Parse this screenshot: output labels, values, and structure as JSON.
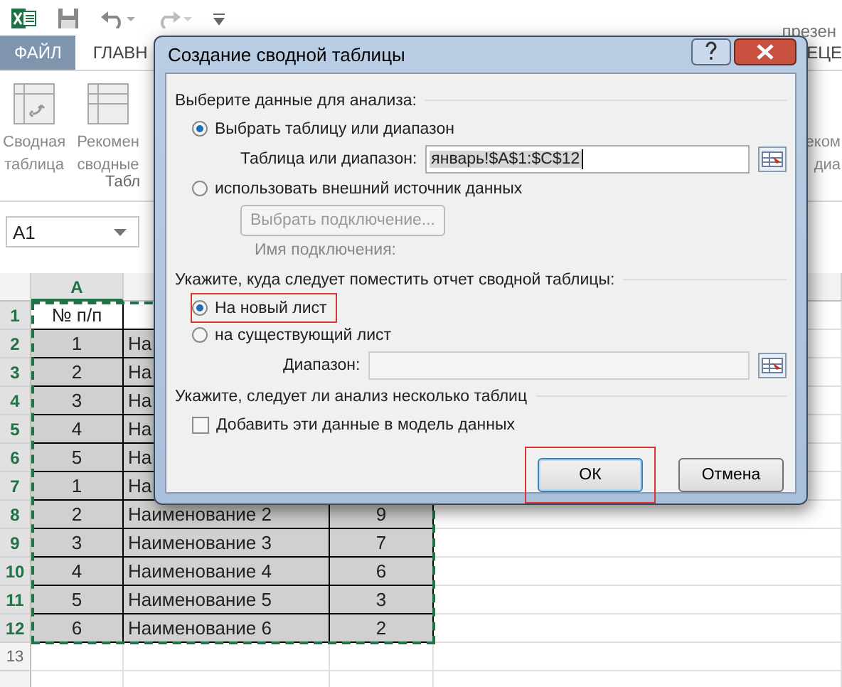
{
  "app": {
    "document_title": "презен"
  },
  "tabs": [
    {
      "label": "ФАЙЛ",
      "kind": "file"
    },
    {
      "label": "ГЛАВН",
      "kind": "tab"
    },
    {
      "label": "ЕЦЕ",
      "kind": "tab"
    }
  ],
  "ribbon": {
    "buttons": [
      {
        "lines": [
          "Сводная",
          "таблица"
        ]
      },
      {
        "lines": [
          "Рекомен",
          "сводные"
        ]
      }
    ],
    "group_label": "Табл",
    "right_button": {
      "lines": [
        "еком",
        "диа"
      ]
    }
  },
  "name_box": {
    "value": "A1"
  },
  "sheet": {
    "columns": [
      "A"
    ],
    "rows": [
      {
        "number": "1",
        "selected": true,
        "shaded": false,
        "cells": [
          "№ п/п"
        ]
      },
      {
        "number": "2",
        "selected": true,
        "shaded": true,
        "cells": [
          "1",
          "На"
        ]
      },
      {
        "number": "3",
        "selected": true,
        "shaded": true,
        "cells": [
          "2",
          "На"
        ]
      },
      {
        "number": "4",
        "selected": true,
        "shaded": true,
        "cells": [
          "3",
          "На"
        ]
      },
      {
        "number": "5",
        "selected": true,
        "shaded": true,
        "cells": [
          "4",
          "На"
        ]
      },
      {
        "number": "6",
        "selected": true,
        "shaded": true,
        "cells": [
          "5",
          "На"
        ]
      },
      {
        "number": "7",
        "selected": true,
        "shaded": true,
        "cells": [
          "1",
          "На"
        ]
      },
      {
        "number": "8",
        "selected": true,
        "shaded": true,
        "cells": [
          "2",
          "Наименование 2",
          "9"
        ]
      },
      {
        "number": "9",
        "selected": true,
        "shaded": true,
        "cells": [
          "3",
          "Наименование 3",
          "7"
        ]
      },
      {
        "number": "10",
        "selected": true,
        "shaded": true,
        "cells": [
          "4",
          "Наименование 4",
          "6"
        ]
      },
      {
        "number": "11",
        "selected": true,
        "shaded": true,
        "cells": [
          "5",
          "Наименование 5",
          "3"
        ]
      },
      {
        "number": "12",
        "selected": true,
        "shaded": true,
        "cells": [
          "6",
          "Наименование 6",
          "2"
        ]
      },
      {
        "number": "13",
        "selected": false,
        "shaded": false,
        "cells": []
      }
    ]
  },
  "dialog": {
    "title": "Создание сводной таблицы",
    "section_data": "Выберите данные для анализа:",
    "source_options": [
      {
        "label": "Выбрать таблицу или диапазон",
        "selected": true
      },
      {
        "label": "использовать внешний источник данных",
        "selected": false
      }
    ],
    "range_label": "Таблица или диапазон:",
    "range_value": "январь!$A$1:$C$12",
    "connection_button": {
      "label": "Выбрать подключение...",
      "disabled": true
    },
    "connection_name_label": "Имя подключения:",
    "section_place": "Укажите, куда следует поместить отчет сводной таблицы:",
    "place_options": [
      {
        "label": "На новый лист",
        "selected": true,
        "highlighted": true
      },
      {
        "label": "на существующий лист",
        "selected": false,
        "highlighted": false
      }
    ],
    "location_label": "Диапазон:",
    "section_multi": "Укажите, следует ли анализ несколько таблиц",
    "model_checkbox": {
      "label": "Добавить эти данные в модель данных",
      "checked": false
    },
    "buttons": [
      {
        "label": "ОК",
        "kind": "primary",
        "highlighted": true
      },
      {
        "label": "Отмена",
        "kind": "cancel",
        "highlighted": false
      }
    ]
  }
}
